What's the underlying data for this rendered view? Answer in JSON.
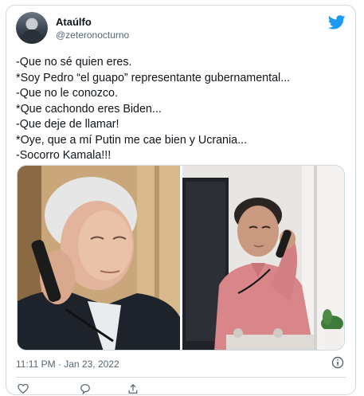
{
  "tweet": {
    "author": {
      "display_name": "Ataúlfo",
      "handle": "@zeteronocturno"
    },
    "text_lines": [
      "-Que no sé quien eres.",
      "*Soy Pedro “el guapo” representante gubernamental...",
      "-Que no le conozco.",
      "*Que cachondo eres Biden...",
      "-Que deje de llamar!",
      "*Oye, que a mí Putin me cae bien y Ucrania...",
      "-Socorro Kamala!!!"
    ],
    "timestamp": "11:11 PM · Jan 23, 2022",
    "icons": {
      "logo": "twitter-bird-icon",
      "info": "info-icon",
      "like": "heart-icon",
      "reply": "reply-icon",
      "share": "share-icon"
    },
    "media": [
      {
        "name": "photo-man-on-phone-left"
      },
      {
        "name": "photo-man-on-phone-right"
      }
    ]
  },
  "colors": {
    "twitter_blue": "#1d9bf0",
    "text": "#0f1419",
    "secondary_text": "#536471",
    "border": "#cfd9de"
  }
}
